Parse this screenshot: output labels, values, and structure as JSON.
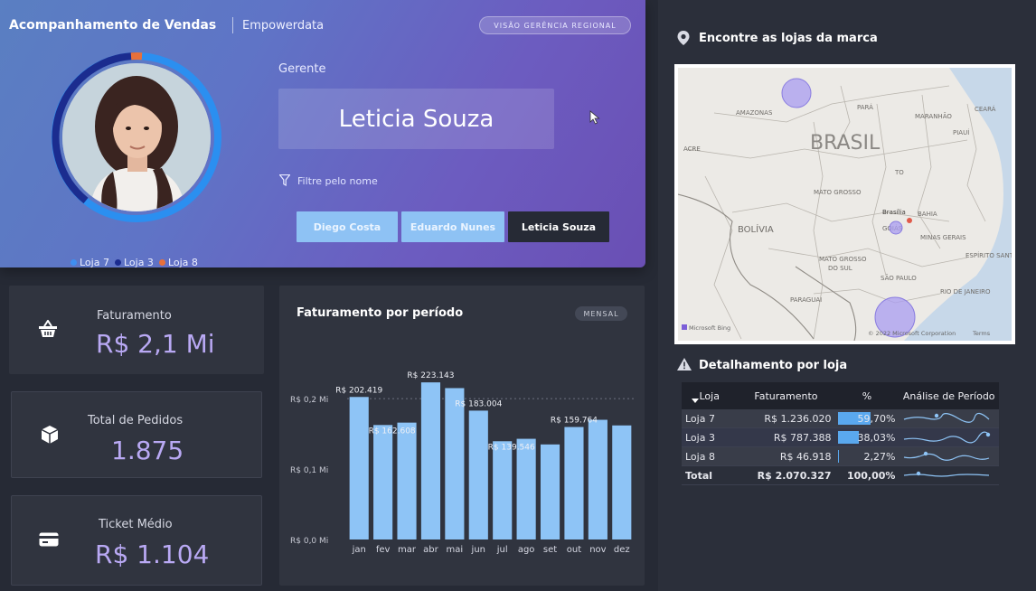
{
  "header": {
    "title": "Acompanhamento de Vendas",
    "subtitle": "Empowerdata",
    "view_badge": "VISÃO GERÊNCIA REGIONAL"
  },
  "manager": {
    "label": "Gerente",
    "name": "Leticia Souza",
    "filter_label": "Filtre pelo nome",
    "options": [
      "Diego Costa",
      "Eduardo Nunes",
      "Leticia Souza"
    ],
    "selected": "Leticia Souza"
  },
  "store_legend": [
    {
      "name": "Loja 7",
      "color": "#3f8ef0"
    },
    {
      "name": "Loja 3",
      "color": "#1b2c8f"
    },
    {
      "name": "Loja 8",
      "color": "#e8703a"
    }
  ],
  "kpis": {
    "faturamento": {
      "label": "Faturamento",
      "value": "R$ 2,1 Mi",
      "icon": "basket-icon"
    },
    "pedidos": {
      "label": "Total de Pedidos",
      "value": "1.875",
      "icon": "box-icon"
    },
    "ticket": {
      "label": "Ticket Médio",
      "value": "R$ 1.104",
      "icon": "card-icon"
    }
  },
  "chart": {
    "title": "Faturamento por período",
    "badge": "MENSAL"
  },
  "chart_data": {
    "type": "bar",
    "categories": [
      "jan",
      "fev",
      "mar",
      "abr",
      "mai",
      "jun",
      "jul",
      "ago",
      "set",
      "out",
      "nov",
      "dez"
    ],
    "values": [
      202419,
      162608,
      166000,
      223143,
      215000,
      183004,
      139546,
      143000,
      135000,
      159764,
      170000,
      162000
    ],
    "data_labels": {
      "0": "R$ 202.419",
      "1": "R$ 162.608",
      "3": "R$ 223.143",
      "5": "R$ 183.004",
      "6": "R$ 139.546",
      "9": "R$ 159.764"
    },
    "yticks": [
      {
        "value": 0,
        "label": "R$ 0,0 Mi"
      },
      {
        "value": 100000,
        "label": "R$ 0,1 Mi"
      },
      {
        "value": 200000,
        "label": "R$ 0,2 Mi"
      }
    ],
    "ylim": [
      0,
      240000
    ],
    "bar_color": "#8ec4f6",
    "reference_line": 200000
  },
  "map": {
    "title": "Encontre as lojas da marca",
    "labels": {
      "country": "BRASIL",
      "bolivia": "BOLÍVIA",
      "paraguai": "PARAGUAI",
      "amazonas": "AMAZONAS",
      "para": "PARÁ",
      "maranhao": "MARANHÃO",
      "ceara": "CEARÁ",
      "piaui": "PIAUÍ",
      "to": "TO",
      "acre": "ACRE",
      "mato_grosso": "MATO GROSSO",
      "goias": "GOIÁS",
      "brasilia": "Brasília",
      "minas": "MINAS GERAIS",
      "espirito": "ESPÍRITO SANTO",
      "ms1": "MATO GROSSO",
      "ms2": "DO SUL",
      "sao_paulo": "SÃO PAULO",
      "rio": "RIO DE JANEIRO",
      "bahia": "BAHIA"
    },
    "attribution": "© 2022 Microsoft Corporation",
    "terms": "Terms",
    "bing": "Microsoft Bing"
  },
  "table": {
    "title": "Detalhamento por loja",
    "headers": [
      "Loja",
      "Faturamento",
      "%",
      "Análise de Período"
    ],
    "rows": [
      {
        "loja": "Loja 7",
        "faturamento": "R$ 1.236.020",
        "pct": "59,70%",
        "pct_value": 0.597
      },
      {
        "loja": "Loja 3",
        "faturamento": "R$ 787.388",
        "pct": "38,03%",
        "pct_value": 0.3803
      },
      {
        "loja": "Loja 8",
        "faturamento": "R$ 46.918",
        "pct": "2,27%",
        "pct_value": 0.0227
      }
    ],
    "total": {
      "loja": "Total",
      "faturamento": "R$ 2.070.327",
      "pct": "100,00%"
    }
  }
}
